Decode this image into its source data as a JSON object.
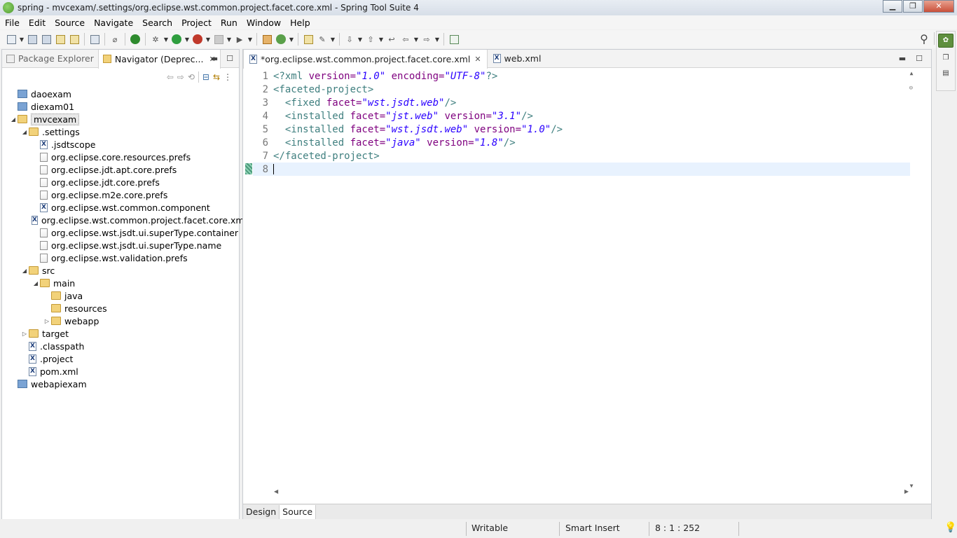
{
  "window": {
    "title": "spring - mvcexam/.settings/org.eclipse.wst.common.project.facet.core.xml - Spring Tool Suite 4",
    "minimize": "▁",
    "maximize": "❐",
    "close": "✕"
  },
  "menu": [
    "File",
    "Edit",
    "Source",
    "Navigate",
    "Search",
    "Project",
    "Run",
    "Window",
    "Help"
  ],
  "left_panel": {
    "tabs": [
      {
        "label": "Package Explorer",
        "active": false
      },
      {
        "label": "Navigator (Deprec...",
        "active": true
      }
    ],
    "tree": [
      {
        "label": "daoexam",
        "depth": 0,
        "type": "project",
        "expanded": null
      },
      {
        "label": "diexam01",
        "depth": 0,
        "type": "project",
        "expanded": null
      },
      {
        "label": "mvcexam",
        "depth": 0,
        "type": "project-open",
        "expanded": true
      },
      {
        "label": ".settings",
        "depth": 1,
        "type": "folder-open",
        "expanded": true
      },
      {
        "label": ".jsdtscope",
        "depth": 2,
        "type": "xml",
        "expanded": null
      },
      {
        "label": "org.eclipse.core.resources.prefs",
        "depth": 2,
        "type": "doc",
        "expanded": null
      },
      {
        "label": "org.eclipse.jdt.apt.core.prefs",
        "depth": 2,
        "type": "doc",
        "expanded": null
      },
      {
        "label": "org.eclipse.jdt.core.prefs",
        "depth": 2,
        "type": "doc",
        "expanded": null
      },
      {
        "label": "org.eclipse.m2e.core.prefs",
        "depth": 2,
        "type": "doc",
        "expanded": null
      },
      {
        "label": "org.eclipse.wst.common.component",
        "depth": 2,
        "type": "xml",
        "expanded": null
      },
      {
        "label": "org.eclipse.wst.common.project.facet.core.xml",
        "depth": 2,
        "type": "xml",
        "expanded": null
      },
      {
        "label": "org.eclipse.wst.jsdt.ui.superType.container",
        "depth": 2,
        "type": "doc",
        "expanded": null
      },
      {
        "label": "org.eclipse.wst.jsdt.ui.superType.name",
        "depth": 2,
        "type": "doc",
        "expanded": null
      },
      {
        "label": "org.eclipse.wst.validation.prefs",
        "depth": 2,
        "type": "doc",
        "expanded": null
      },
      {
        "label": "src",
        "depth": 1,
        "type": "folder-open",
        "expanded": true
      },
      {
        "label": "main",
        "depth": 2,
        "type": "folder-open",
        "expanded": true
      },
      {
        "label": "java",
        "depth": 3,
        "type": "folder-open",
        "expanded": null
      },
      {
        "label": "resources",
        "depth": 3,
        "type": "folder-open",
        "expanded": null
      },
      {
        "label": "webapp",
        "depth": 3,
        "type": "folder-open",
        "expanded": false
      },
      {
        "label": "target",
        "depth": 1,
        "type": "folder-open",
        "expanded": false
      },
      {
        "label": ".classpath",
        "depth": 1,
        "type": "xml",
        "expanded": null
      },
      {
        "label": ".project",
        "depth": 1,
        "type": "xml",
        "expanded": null
      },
      {
        "label": "pom.xml",
        "depth": 1,
        "type": "xml",
        "expanded": null
      },
      {
        "label": "webapiexam",
        "depth": 0,
        "type": "project",
        "expanded": null
      }
    ]
  },
  "editor": {
    "tabs": [
      {
        "label": "*org.eclipse.wst.common.project.facet.core.xml",
        "active": true,
        "closable": true
      },
      {
        "label": "web.xml",
        "active": false,
        "closable": false
      }
    ],
    "lines": [
      {
        "n": "1",
        "html": [
          [
            "pi",
            "<?xml "
          ],
          [
            "attr",
            "version="
          ],
          [
            "val",
            "\"1.0\""
          ],
          [
            "pi",
            " "
          ],
          [
            "attr",
            "encoding="
          ],
          [
            "val",
            "\"UTF-8\""
          ],
          [
            "pi",
            "?>"
          ]
        ]
      },
      {
        "n": "2",
        "fold": true,
        "html": [
          [
            "tag",
            "<faceted-project>"
          ]
        ]
      },
      {
        "n": "3",
        "html": [
          [
            "tag",
            "  <fixed "
          ],
          [
            "attr",
            "facet="
          ],
          [
            "val",
            "\"wst.jsdt.web\""
          ],
          [
            "tag",
            "/>"
          ]
        ]
      },
      {
        "n": "4",
        "html": [
          [
            "tag",
            "  <installed "
          ],
          [
            "attr",
            "facet="
          ],
          [
            "val",
            "\"jst.web\""
          ],
          [
            "tag",
            " "
          ],
          [
            "attr",
            "version="
          ],
          [
            "val",
            "\"3.1\""
          ],
          [
            "tag",
            "/>"
          ]
        ]
      },
      {
        "n": "5",
        "html": [
          [
            "tag",
            "  <installed "
          ],
          [
            "attr",
            "facet="
          ],
          [
            "val",
            "\"wst.jsdt.web\""
          ],
          [
            "tag",
            " "
          ],
          [
            "attr",
            "version="
          ],
          [
            "val",
            "\"1.0\""
          ],
          [
            "tag",
            "/>"
          ]
        ]
      },
      {
        "n": "6",
        "html": [
          [
            "tag",
            "  <installed "
          ],
          [
            "attr",
            "facet="
          ],
          [
            "val",
            "\"java\""
          ],
          [
            "tag",
            " "
          ],
          [
            "attr",
            "version="
          ],
          [
            "val",
            "\"1.8\""
          ],
          [
            "tag",
            "/>"
          ]
        ]
      },
      {
        "n": "7",
        "html": [
          [
            "tag",
            "</faceted-project>"
          ]
        ]
      },
      {
        "n": "8",
        "current": true,
        "html": []
      }
    ],
    "bottom_tabs": [
      {
        "label": "Design",
        "active": false
      },
      {
        "label": "Source",
        "active": true
      }
    ]
  },
  "status": {
    "writable": "Writable",
    "insert_mode": "Smart Insert",
    "position": "8 : 1 : 252"
  },
  "colors": {
    "tag": "#3f7f7f",
    "attr": "#7f007f",
    "value": "#2a00ff",
    "current_line": "#e8f2fe"
  }
}
